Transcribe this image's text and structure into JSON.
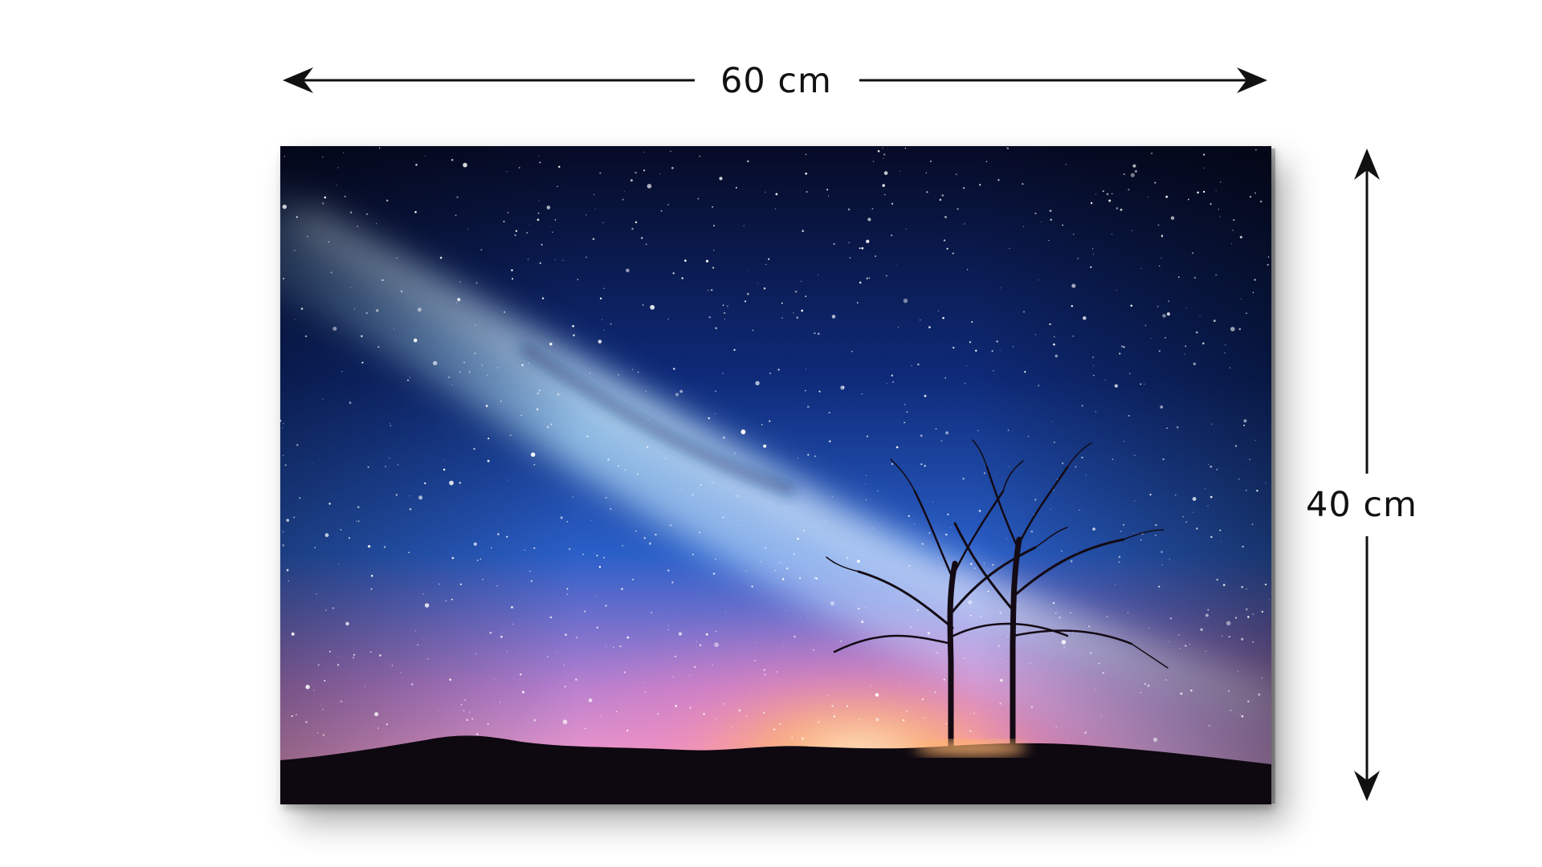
{
  "dimensions": {
    "width_label": "60 cm",
    "height_label": "40 cm"
  },
  "artwork": {
    "subject-icon": "milky-way-night-sky-with-two-trees"
  },
  "colors": {
    "arrow": "#111111",
    "sky_top": "#050a24",
    "sky_mid": "#1746a8",
    "galaxy_glow": "#8fd0ff",
    "horizon_pink": "#e59ad6",
    "horizon_glow": "#ffb070",
    "ground": "#100a12"
  }
}
